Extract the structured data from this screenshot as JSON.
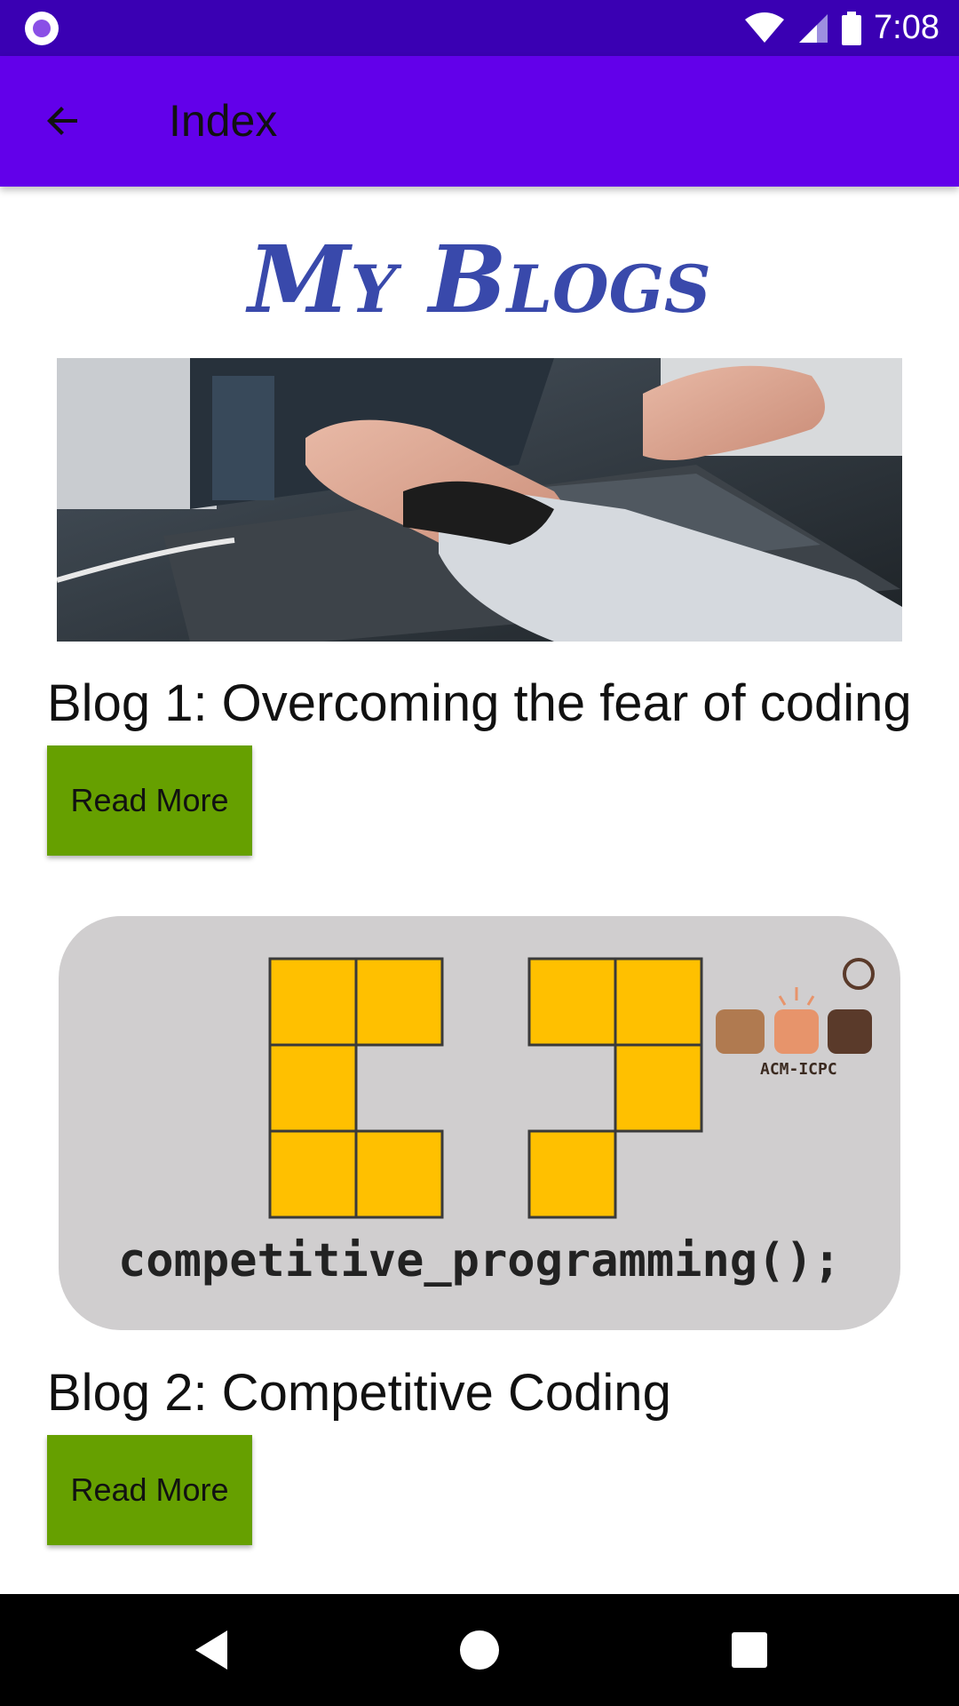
{
  "status_bar": {
    "time": "7:08",
    "icons": [
      "notification-dot-icon",
      "wifi-icon",
      "cell-signal-icon",
      "battery-icon"
    ]
  },
  "app_bar": {
    "title": "Index",
    "back_icon": "arrow-left-icon"
  },
  "page": {
    "heading": "My Blogs"
  },
  "blogs": [
    {
      "title": "Blog 1: Overcoming the fear of coding",
      "button_label": "Read More",
      "image": "laptop-hands-photo"
    },
    {
      "title": "Blog 2: Competitive Coding",
      "button_label": "Read More",
      "image": "competitive-programming-logo",
      "image_text": "competitive_programming();",
      "image_badge": "ACM-ICPC"
    }
  ],
  "nav_bar": {
    "icons": [
      "back-triangle-icon",
      "home-circle-icon",
      "recents-square-icon"
    ]
  },
  "colors": {
    "status_bar": "#3a00b3",
    "app_bar": "#6200ea",
    "heading": "#3949ab",
    "button": "#66a000",
    "logo_tile": "#ffc000"
  }
}
